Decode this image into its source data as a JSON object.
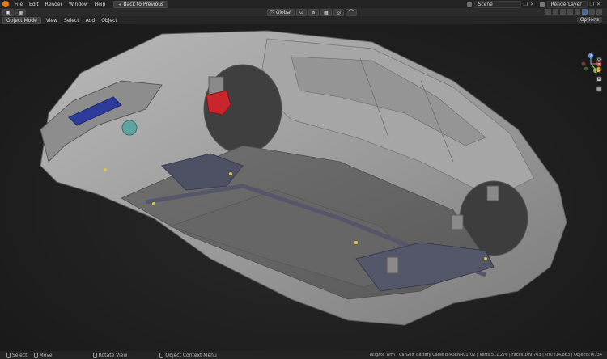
{
  "topbar": {
    "menu": [
      "File",
      "Edit",
      "Render",
      "Window",
      "Help"
    ],
    "back_button": "Back to Previous",
    "scene": "Scene",
    "view_layer": "RenderLayer"
  },
  "header2": {
    "transform_orientation": "Global"
  },
  "header3": {
    "mode": "Object Mode",
    "menu": [
      "View",
      "Select",
      "Add",
      "Object"
    ],
    "options": "Options"
  },
  "gizmo": {
    "x": "X",
    "y": "Y",
    "z": "Z"
  },
  "statusbar": {
    "select": "Select",
    "move": "Move",
    "rotate_view": "Rotate View",
    "context_menu": "Object Context Menu",
    "stats": "Tailgate_Arm | CarGolf_Battery Cable B-R3ENR01_02 | Verts:511,276 | Faces:109,763 | Tris:214,863 | Objects:0/134"
  },
  "colors": {
    "accent": "#e87d0d",
    "viewport_bg": "#202020",
    "header_bg": "#2b2b2b"
  }
}
